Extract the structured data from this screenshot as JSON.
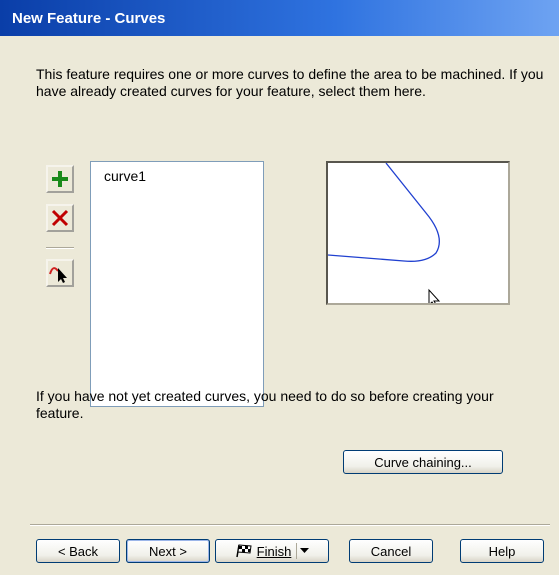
{
  "window": {
    "title": "New Feature - Curves"
  },
  "intro": {
    "text": "This feature requires one or more curves to define the area to be machined.  If you have already created curves for your feature, select them here."
  },
  "toolbar": {
    "add_icon": "plus-icon",
    "delete_icon": "red-x-icon",
    "select_icon": "curve-select-cursor-icon"
  },
  "curves": {
    "items": [
      "curve1"
    ]
  },
  "info": {
    "text": "If you have not yet created curves, you need to do so before creating your feature."
  },
  "buttons": {
    "curve_chaining": "Curve chaining...",
    "back": "< Back",
    "next": "Next >",
    "finish": "Finish",
    "cancel": "Cancel",
    "help": "Help"
  },
  "colors": {
    "titlebar": "#0a3ea8",
    "curve": "#2040d0",
    "plus": "#1a8a1a",
    "delete": "#c00000"
  }
}
